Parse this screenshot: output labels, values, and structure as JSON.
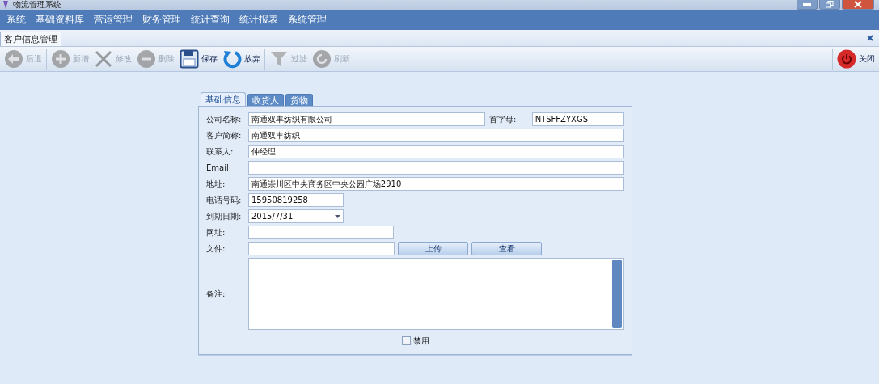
{
  "window": {
    "title": "物流管理系统"
  },
  "menu": [
    {
      "label": "系统"
    },
    {
      "label": "基础资料库"
    },
    {
      "label": "营运管理"
    },
    {
      "label": "财务管理"
    },
    {
      "label": "统计查询"
    },
    {
      "label": "统计报表"
    },
    {
      "label": "系统管理"
    }
  ],
  "doc_tab": {
    "label": "客户信息管理",
    "selected": true
  },
  "toolbar": [
    {
      "kind": "back",
      "label": "后退",
      "disabled": true
    },
    {
      "kind": "add",
      "label": "新增",
      "disabled": true
    },
    {
      "kind": "edit",
      "label": "修改",
      "disabled": true
    },
    {
      "kind": "delete",
      "label": "删除",
      "disabled": true
    },
    {
      "kind": "save",
      "label": "保存",
      "disabled": false
    },
    {
      "kind": "undo",
      "label": "放弃",
      "disabled": false
    },
    {
      "kind": "filter",
      "label": "过滤",
      "disabled": true
    },
    {
      "kind": "refresh",
      "label": "刷新",
      "disabled": true
    }
  ],
  "close_button": {
    "label": "关闭"
  },
  "form_tabs": [
    {
      "label": "基础信息",
      "selected": true
    },
    {
      "label": "收货人",
      "selected": false
    },
    {
      "label": "货物",
      "selected": false
    }
  ],
  "fields": [
    {
      "kind": "pair",
      "label": "公司名称:",
      "value": "南通双丰纺织有限公司",
      "side_label": "首字母:",
      "side_value": "NTSFFZYXGS"
    },
    {
      "kind": "wide",
      "label": "客户简称:",
      "value": "南通双丰纺织"
    },
    {
      "kind": "wide",
      "label": "联系人:",
      "value": "仲经理"
    },
    {
      "kind": "wide",
      "label": "Email:"
    },
    {
      "kind": "wide",
      "label": "地址:",
      "value": "南通崇川区中央商务区中央公园广场2910"
    },
    {
      "kind": "short",
      "label": "电话号码:",
      "value": "15950819258"
    },
    {
      "kind": "date",
      "label": "到期日期:",
      "value": "2015/7/31"
    },
    {
      "kind": "medium",
      "label": "网址:"
    },
    {
      "kind": "file",
      "label": "文件:",
      "buttons": [
        "上传",
        "查看"
      ]
    },
    {
      "kind": "memo",
      "label": "备注:"
    }
  ],
  "disabled_checkbox": {
    "label": "禁用",
    "checked": false
  }
}
